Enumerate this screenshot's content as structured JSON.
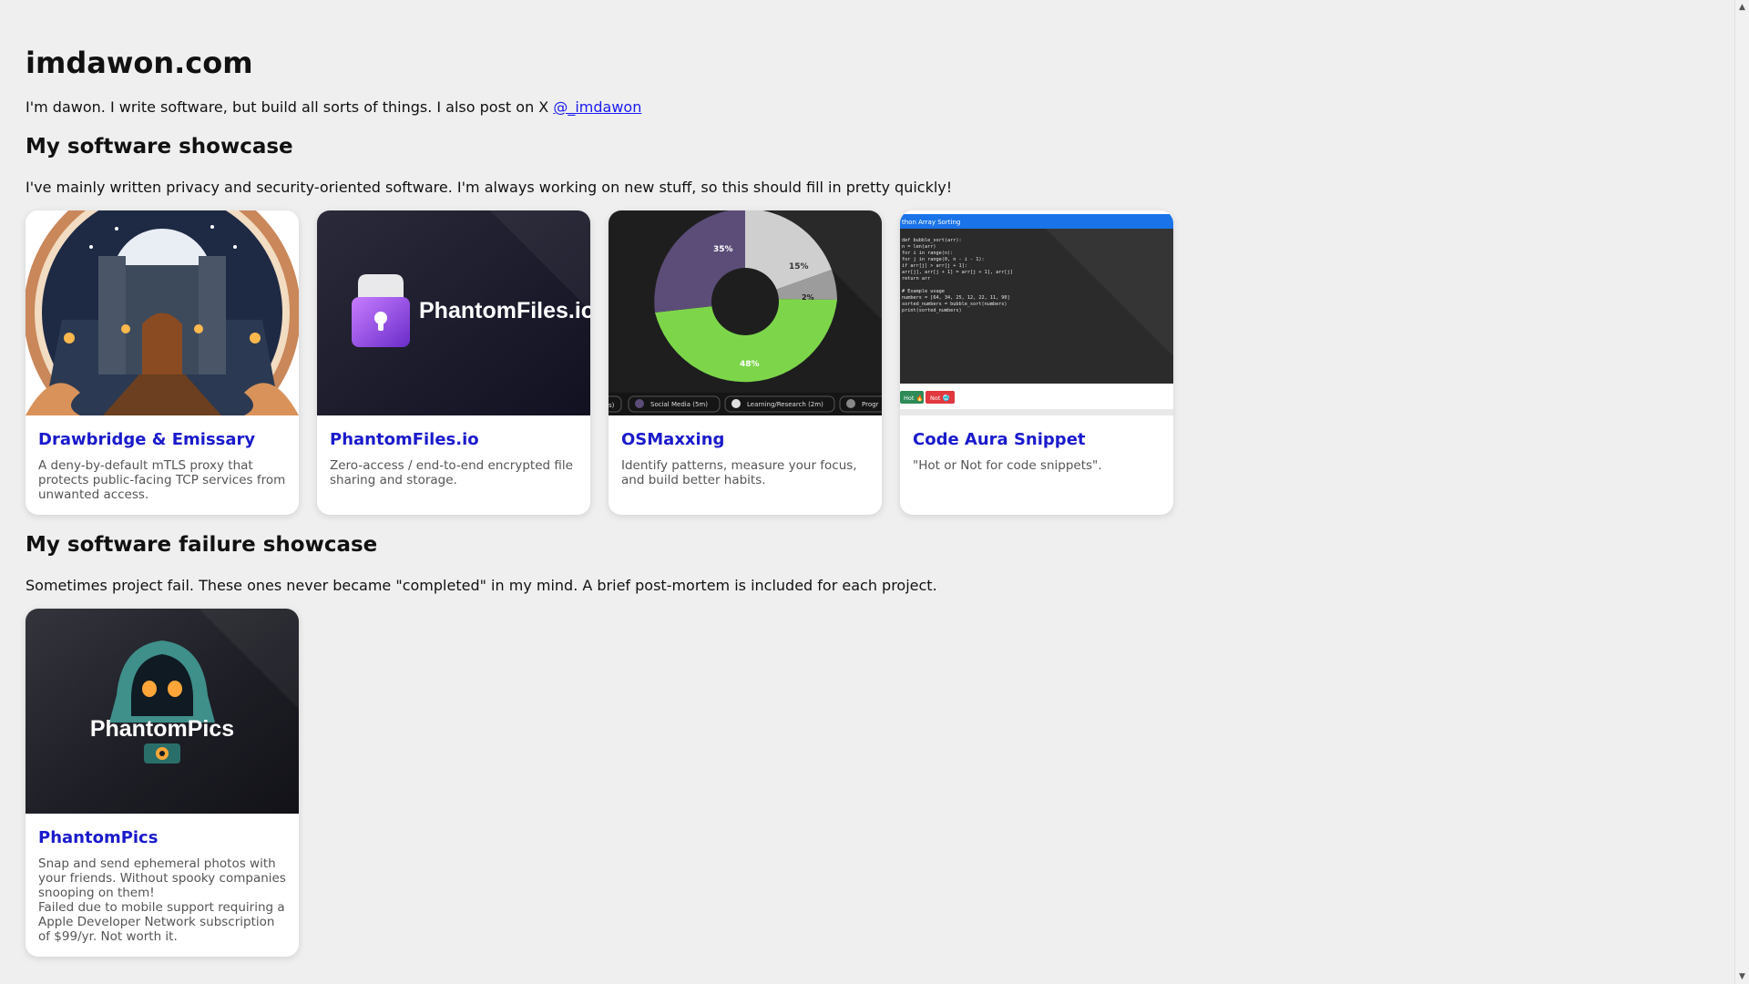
{
  "site": {
    "title": "imdawon.com",
    "intro_text": "I'm dawon. I write software, but build all sorts of things. I also post on X ",
    "intro_link": "@_imdawon"
  },
  "showcase": {
    "heading": "My software showcase",
    "description": "I've mainly written privacy and security-oriented software. I'm always working on new stuff, so this should fill in pretty quickly!",
    "projects": [
      {
        "title": "Drawbridge & Emissary",
        "description": "A deny-by-default mTLS proxy that protects public-facing TCP services from unwanted access."
      },
      {
        "title": "PhantomFiles.io",
        "description": "Zero-access / end-to-end encrypted file sharing and storage.",
        "logo_text": "PhantomFiles.io"
      },
      {
        "title": "OSMaxxing",
        "description": "Identify patterns, measure your focus, and build better habits.",
        "chart_labels": [
          "35%",
          "15%",
          "2%",
          "48%"
        ],
        "legend": [
          "s)",
          "Social Media (5m)",
          "Learning/Research (2m)",
          "Progr"
        ]
      },
      {
        "title": "Code Aura Snippet",
        "description": "\"Hot or Not for code snippets\".",
        "header_text": "thon Array Sorting",
        "code": [
          "def bubble_sort(arr):",
          "    n = len(arr)",
          "    for i in range(n):",
          "        for j in range(0, n - i - 1):",
          "            if arr[j] > arr[j + 1]:",
          "                arr[j], arr[j + 1] = arr[j + 1], arr[j]",
          "    return arr",
          "",
          "# Example usage",
          "numbers = [64, 34, 25, 12, 22, 11, 90]",
          "sorted_numbers = bubble_sort(numbers)",
          "print(sorted_numbers)"
        ],
        "hot_label": "Hot 🔥",
        "not_label": "Not 🥶"
      }
    ]
  },
  "failures": {
    "heading": "My software failure showcase",
    "description": "Sometimes project fail. These ones never became \"completed\" in my mind. A brief post-mortem is included for each project.",
    "projects": [
      {
        "title": "PhantomPics",
        "description": "Snap and send ephemeral photos with your friends. Without spooky companies snooping on them!\nFailed due to mobile support requiring a Apple Developer Network subscription of $99/yr. Not worth it.",
        "logo_text": "PhantomPics"
      }
    ]
  },
  "colors": {
    "link": "#1a1aee",
    "card_title": "#1a1acc",
    "background": "#efefef"
  }
}
